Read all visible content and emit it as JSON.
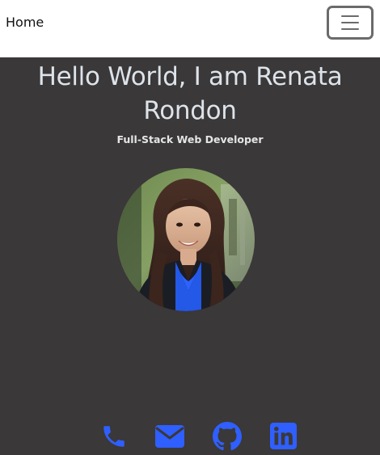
{
  "navbar": {
    "home_label": "Home",
    "toggler_icon": "hamburger-menu-icon"
  },
  "hero": {
    "title": "Hello World, I am Renata Rondon",
    "subtitle": "Full-Stack Web Developer"
  },
  "contact": {
    "items": [
      {
        "icon": "phone-icon"
      },
      {
        "icon": "envelope-icon"
      },
      {
        "icon": "github-icon"
      },
      {
        "icon": "linkedin-icon"
      }
    ],
    "icon_color": "#2f5fff"
  },
  "colors": {
    "navbar_bg": "#ffffff",
    "page_bg": "#3a3838",
    "title_color": "#dde3ea",
    "accent": "#2f5fff"
  }
}
